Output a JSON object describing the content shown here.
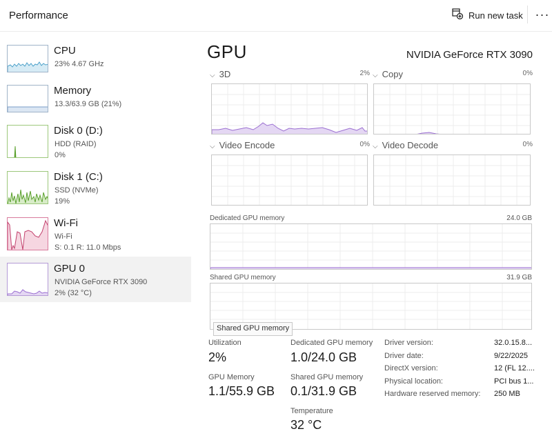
{
  "header": {
    "title": "Performance",
    "run_new_task": "Run new task",
    "more": "···"
  },
  "sidebar": {
    "items": [
      {
        "name": "CPU",
        "sub1": "23%  4.67 GHz",
        "sub2": ""
      },
      {
        "name": "Memory",
        "sub1": "13.3/63.9 GB (21%)",
        "sub2": ""
      },
      {
        "name": "Disk 0 (D:)",
        "sub1": "HDD (RAID)",
        "sub2": "0%"
      },
      {
        "name": "Disk 1 (C:)",
        "sub1": "SSD (NVMe)",
        "sub2": "19%"
      },
      {
        "name": "Wi-Fi",
        "sub1": "Wi-Fi",
        "sub2": "S: 0.1  R: 11.0 Mbps"
      },
      {
        "name": "GPU 0",
        "sub1": "NVIDIA GeForce RTX 3090",
        "sub2": "2% (32 °C)"
      }
    ],
    "selected": "GPU 0"
  },
  "main": {
    "title": "GPU",
    "model": "NVIDIA GeForce RTX 3090",
    "engines": [
      {
        "label": "3D",
        "percent": "2%"
      },
      {
        "label": "Copy",
        "percent": "0%"
      },
      {
        "label": "Video Encode",
        "percent": "0%"
      },
      {
        "label": "Video Decode",
        "percent": "0%"
      }
    ],
    "dedicated_memory": {
      "label": "Dedicated GPU memory",
      "max": "24.0 GB"
    },
    "shared_memory": {
      "label": "Shared GPU memory",
      "max": "31.9 GB"
    },
    "tooltip": "Shared GPU memory"
  },
  "stats": {
    "utilization": {
      "label": "Utilization",
      "value": "2%"
    },
    "dedicated": {
      "label": "Dedicated GPU memory",
      "value": "1.0/24.0 GB"
    },
    "gpu_memory": {
      "label": "GPU Memory",
      "value": "1.1/55.9 GB"
    },
    "shared": {
      "label": "Shared GPU memory",
      "value": "0.1/31.9 GB"
    },
    "temperature": {
      "label": "Temperature",
      "value": "32 °C"
    }
  },
  "info": [
    {
      "label": "Driver version:",
      "value": "32.0.15.8..."
    },
    {
      "label": "Driver date:",
      "value": "9/22/2025"
    },
    {
      "label": "DirectX version:",
      "value": "12 (FL 12...."
    },
    {
      "label": "Physical location:",
      "value": "PCI bus 1..."
    },
    {
      "label": "Hardware reserved memory:",
      "value": "250 MB"
    }
  ],
  "colors": {
    "gpu_line": "#9b6fd1",
    "gpu_fill": "#e4d7f3",
    "cpu_line": "#4aa0c9",
    "mem_line": "#7a9cc9",
    "disk_line": "#5aa02c",
    "wifi_line": "#c2416d",
    "grid": "#ececec"
  },
  "icons": {
    "run_task": "run-task-icon",
    "chevron": "chevron-down-icon"
  }
}
